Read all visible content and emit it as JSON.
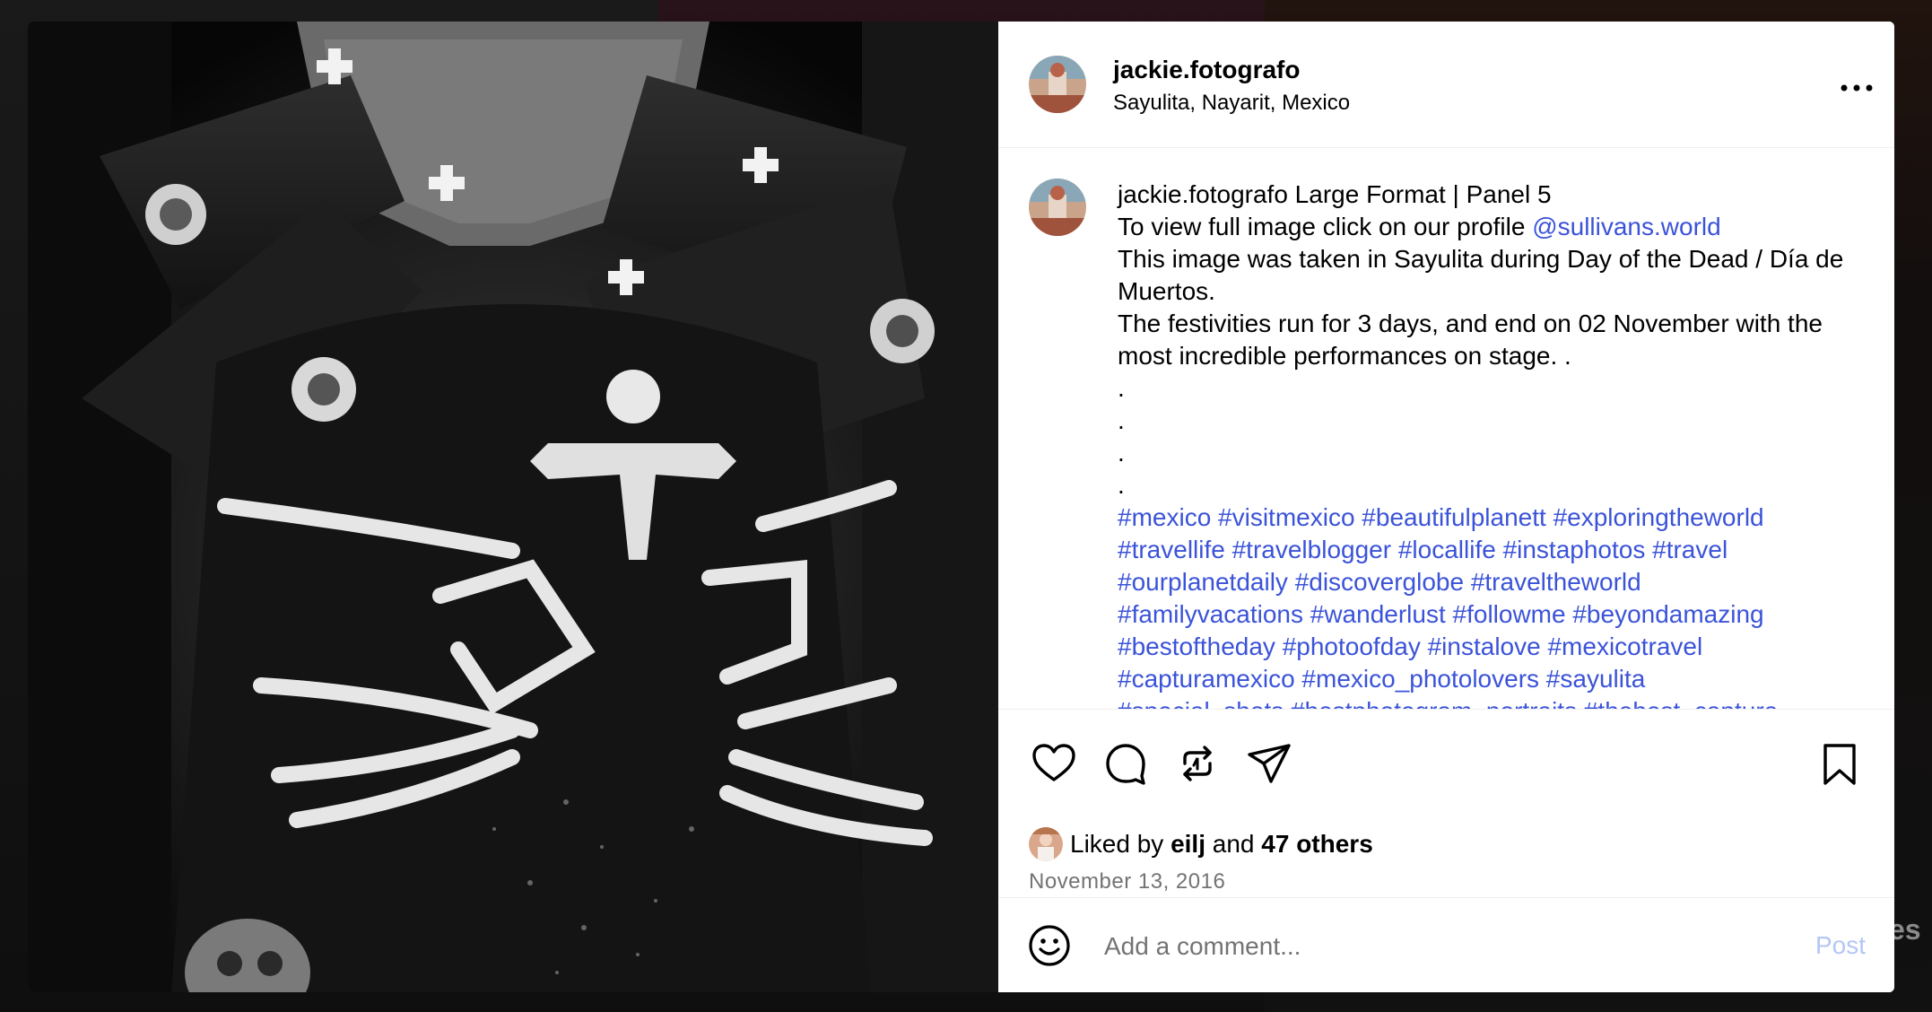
{
  "post": {
    "username": "jackie.fotografo",
    "location": "Sayulita, Nayarit, Mexico",
    "caption": {
      "username": "jackie.fotografo",
      "title": "Large Format | Panel 5",
      "line2_prefix": "To view full image click on our profile",
      "mention": "@sullivans.world",
      "line3": "This image was taken in Sayulita during Day of the Dead / Día de Muertos.",
      "line4": "The festivities run for 3 days, and end on 02 November with the most incredible performances on stage. .",
      "dots": [
        ".",
        ".",
        ".",
        "."
      ],
      "hashtag_lines": [
        "#mexico #visitmexico #beautifulplanett #exploringtheworld",
        "#travellife #travelblogger #locallife #instaphotos #travel",
        "#ourplanetdaily #discoverglobe #traveltheworld",
        "#familyvacations #wanderlust #followme #beyondamazing",
        "#bestoftheday #photoofday #instalove #mexicotravel",
        "#capturamexico #mexico_photolovers #sayulita",
        "#special_shots #bestphotogram_portraits #thebest_capture"
      ]
    },
    "likes": {
      "prefix": "Liked by",
      "user": "eilj",
      "joiner": "and",
      "others": "47 others"
    },
    "date": "November 13, 2016",
    "comment": {
      "placeholder": "Add a comment...",
      "post_label": "Post"
    },
    "icons": {
      "like": "heart-icon",
      "comment": "comment-bubble-icon",
      "repost": "repost-icon",
      "share": "paper-plane-icon",
      "save": "bookmark-icon",
      "more": "ellipsis-icon",
      "emoji": "smiley-icon"
    }
  },
  "backdrop": {
    "partial_text": "es"
  },
  "colors": {
    "link": "#3b53d8",
    "muted": "#737373",
    "post_disabled": "#b3c6f5"
  }
}
